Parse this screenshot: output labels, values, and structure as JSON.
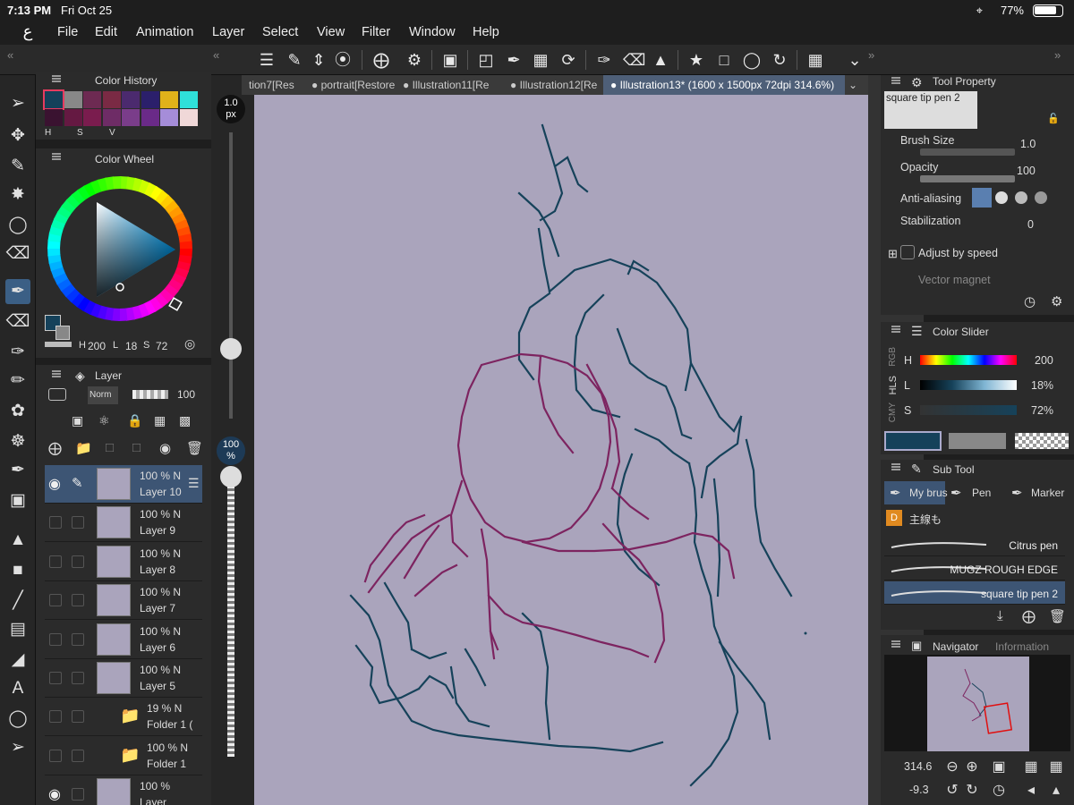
{
  "status": {
    "time": "7:13 PM",
    "date": "Fri Oct 25",
    "battery": "77%"
  },
  "menu": [
    "File",
    "Edit",
    "Animation",
    "Layer",
    "Select",
    "View",
    "Filter",
    "Window",
    "Help"
  ],
  "tabs": [
    {
      "label": "tion7[Res"
    },
    {
      "label": "portrait[Restore"
    },
    {
      "label": "Illustration11[Re"
    },
    {
      "label": "Illustration12[Re"
    },
    {
      "label": "Illustration13* (1600 x 1500px 72dpi 314.6%)"
    }
  ],
  "brush_size_display": {
    "value": "1.0",
    "unit": "px"
  },
  "zoom_display": {
    "value": "100",
    "unit": "%"
  },
  "color_history": {
    "title": "Color History",
    "mode_letters": [
      "H",
      "S",
      "V"
    ],
    "swatches": [
      "#15415a",
      "#888888",
      "#6d2a52",
      "#7a2a44",
      "#4b2a6e",
      "#2b1f6b",
      "#e0b21a",
      "#2fe0d9",
      "#3a1230",
      "#651942",
      "#7a1c4e",
      "#6e2c66",
      "#7a3d8a",
      "#6a2a88",
      "#a58dd9",
      "#f0d8d8"
    ]
  },
  "color_wheel": {
    "title": "Color Wheel",
    "h_label": "H",
    "h_value": "200",
    "l_label": "L",
    "l_value": "18",
    "s_label": "S",
    "s_value": "72",
    "main_color": "#15415a"
  },
  "layer_panel": {
    "title": "Layer",
    "blend_mode": "Norm",
    "opacity": "100",
    "layers": [
      {
        "opacity": "100 %",
        "mode": "N",
        "name": "Layer 10",
        "selected": true
      },
      {
        "opacity": "100 %",
        "mode": "N",
        "name": "Layer 9"
      },
      {
        "opacity": "100 %",
        "mode": "N",
        "name": "Layer 8"
      },
      {
        "opacity": "100 %",
        "mode": "N",
        "name": "Layer 7"
      },
      {
        "opacity": "100 %",
        "mode": "N",
        "name": "Layer 6"
      },
      {
        "opacity": "100 %",
        "mode": "N",
        "name": "Layer 5"
      },
      {
        "opacity": "19 %",
        "mode": "N",
        "name": "Folder 1 ("
      },
      {
        "opacity": "100 %",
        "mode": "N",
        "name": "Folder 1"
      },
      {
        "opacity": "100 %",
        "mode": "",
        "name": "Layer"
      }
    ]
  },
  "tool_property": {
    "title": "Tool Property",
    "brush_name": "square tip pen 2",
    "brush_size_label": "Brush Size",
    "brush_size_value": "1.0",
    "opacity_label": "Opacity",
    "opacity_value": "100",
    "antialias_label": "Anti-aliasing",
    "stabilization_label": "Stabilization",
    "stabilization_value": "0",
    "adjust_speed_label": "Adjust by speed",
    "vector_magnet_label": "Vector magnet"
  },
  "color_slider": {
    "title": "Color Slider",
    "modes": [
      "RGB",
      "HLS",
      "CMY"
    ],
    "h_label": "H",
    "h_value": "200",
    "l_label": "L",
    "l_value": "18%",
    "s_label": "S",
    "s_value": "72%"
  },
  "sub_tool": {
    "title": "Sub Tool",
    "tabs": [
      "My brus",
      "Pen",
      "Marker",
      "主線も"
    ],
    "brushes": [
      "Citrus pen",
      "MUGZ ROUGH EDGE",
      "square tip pen 2"
    ]
  },
  "navigator": {
    "title": "Navigator",
    "info_tab": "Information",
    "zoom_value": "314.6",
    "rotate_value": "-9.3"
  },
  "colors": {
    "canvas_paper": "#aaa4bc",
    "sketch_teal": "#16425a",
    "sketch_magenta": "#7d2460",
    "selection_blue": "#3d5574"
  }
}
